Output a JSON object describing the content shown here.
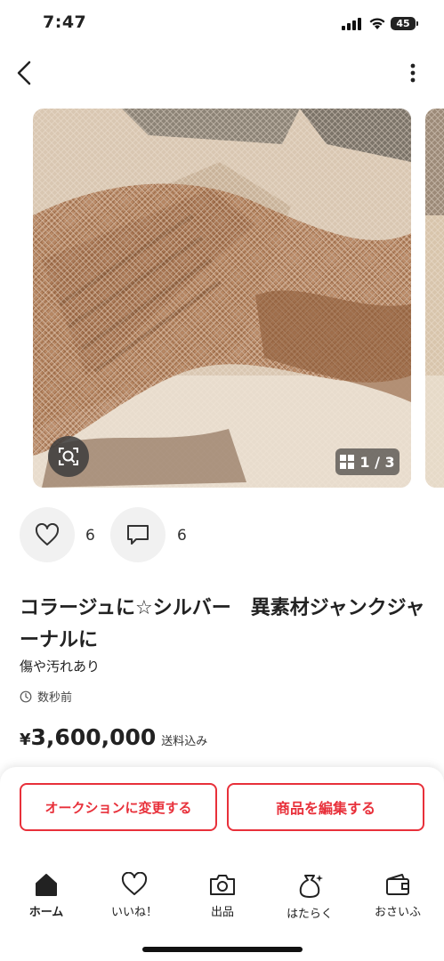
{
  "status": {
    "time": "7:47",
    "battery": "45"
  },
  "gallery": {
    "counter": "1 / 3"
  },
  "reactions": {
    "likes": "6",
    "comments": "6"
  },
  "item": {
    "title": "コラージュに☆シルバー　異素材ジャンクジャーナルに",
    "condition": "傷や汚れあり",
    "posted": "数秒前",
    "currency": "¥",
    "price": "3,600,000",
    "shipping": "送料込み"
  },
  "actions": {
    "auction": "オークションに変更する",
    "edit": "商品を編集する"
  },
  "tabs": [
    {
      "label": "ホーム",
      "icon": "home-icon"
    },
    {
      "label": "いいね！",
      "icon": "heart-icon"
    },
    {
      "label": "出品",
      "icon": "camera-icon"
    },
    {
      "label": "はたらく",
      "icon": "money-bag-icon"
    },
    {
      "label": "おさいふ",
      "icon": "wallet-icon"
    }
  ],
  "colors": {
    "accent": "#e8303a"
  }
}
